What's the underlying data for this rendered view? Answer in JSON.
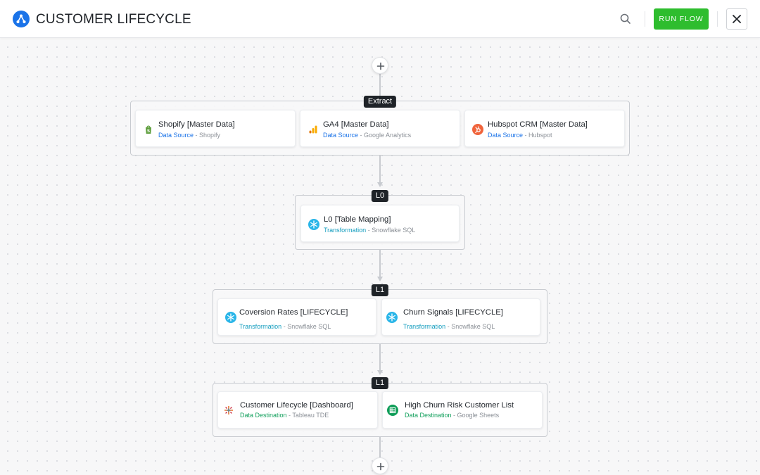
{
  "header": {
    "title": "CUSTOMER LIFECYCLE",
    "run_label": "RUN FLOW",
    "icons": {
      "logo": "flow-logo-icon",
      "search": "search-icon",
      "close": "close-icon"
    }
  },
  "colors": {
    "accent": "#1a73e8",
    "run_button": "#2ebd2e",
    "data_source": "#1a73e8",
    "transformation": "#0f9bbd",
    "data_destination": "#12a05c",
    "group_label_bg": "#1f2328"
  },
  "groups": [
    {
      "label": "Extract",
      "nodes": [
        {
          "title": "Shopify [Master Data]",
          "kind": "Data Source",
          "provider": "Shopify",
          "icon": "shopify-icon"
        },
        {
          "title": "GA4 [Master Data]",
          "kind": "Data Source",
          "provider": "Google Analytics",
          "icon": "google-analytics-icon"
        },
        {
          "title": "Hubspot CRM [Master Data]",
          "kind": "Data Source",
          "provider": "Hubspot",
          "icon": "hubspot-icon"
        }
      ]
    },
    {
      "label": "L0",
      "nodes": [
        {
          "title": "L0 [Table Mapping]",
          "kind": "Transformation",
          "provider": "Snowflake SQL",
          "icon": "snowflake-icon"
        }
      ]
    },
    {
      "label": "L1",
      "nodes": [
        {
          "title": "Coversion Rates [LIFECYCLE]",
          "kind": "Transformation",
          "provider": "Snowflake SQL",
          "icon": "snowflake-icon"
        },
        {
          "title": "Churn Signals [LIFECYCLE]",
          "kind": "Transformation",
          "provider": "Snowflake SQL",
          "icon": "snowflake-icon"
        }
      ]
    },
    {
      "label": "L1",
      "nodes": [
        {
          "title": "Customer Lifecycle [Dashboard]",
          "kind": "Data Destination",
          "provider": "Tableau TDE",
          "icon": "tableau-icon"
        },
        {
          "title": "High Churn Risk Customer List",
          "kind": "Data Destination",
          "provider": "Google Sheets",
          "icon": "google-sheets-icon"
        }
      ]
    }
  ],
  "separator": " - "
}
